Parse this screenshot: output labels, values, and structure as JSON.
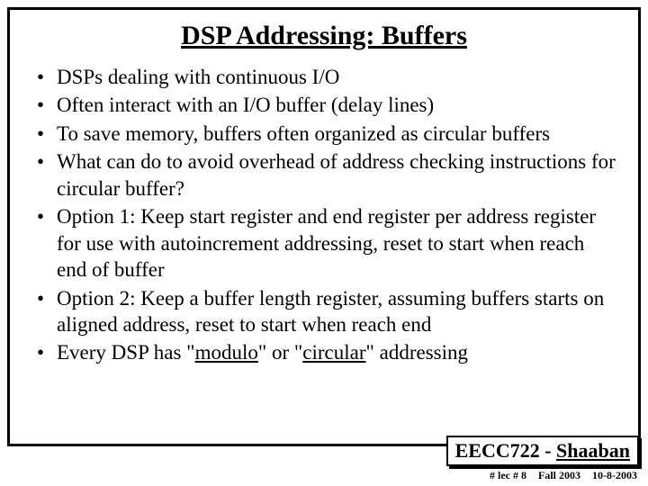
{
  "title": "DSP Addressing: Buffers",
  "bullets": [
    {
      "text": "DSPs dealing with continuous I/O"
    },
    {
      "text": "Often interact with an I/O buffer (delay lines)"
    },
    {
      "text": "To save memory, buffers often organized as circular buffers"
    },
    {
      "text": "What can do to avoid overhead of address checking instructions for circular buffer?"
    },
    {
      "text": "Option 1: Keep start register and end register per address register for use with autoincrement addressing, reset to start when reach end of buffer"
    },
    {
      "text": "Option 2: Keep a buffer length register, assuming buffers starts on aligned address, reset to start when reach end"
    },
    {
      "html": "Every DSP has \"<span class=\"u\">modulo</span>\" or \"<span class=\"u\">circular</span>\" addressing"
    }
  ],
  "footer": {
    "course": "EECC722",
    "sep": " - ",
    "author": "Shaaban",
    "lec": "#  lec # 8",
    "term": "Fall 2003",
    "date": "10-8-2003"
  }
}
